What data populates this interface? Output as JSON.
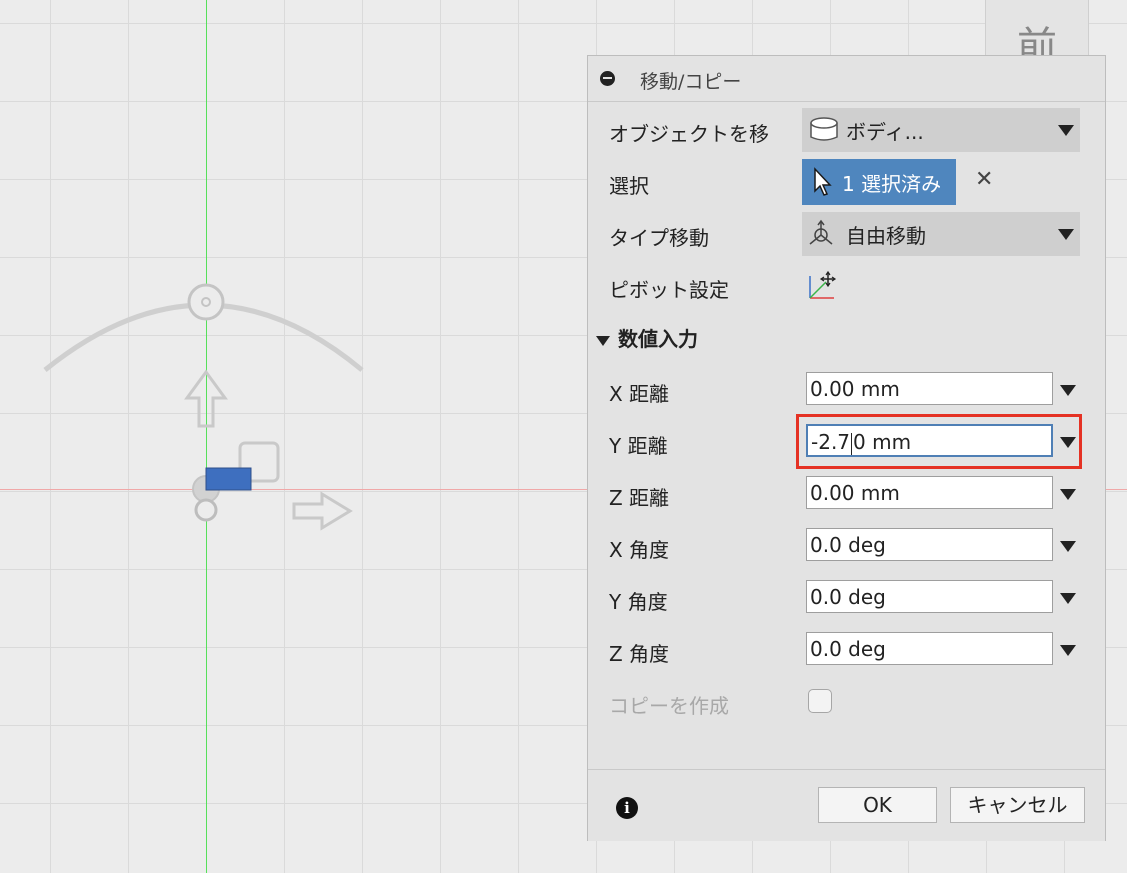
{
  "viewcube": {
    "label": "前"
  },
  "dialog": {
    "title": "移動/コピー",
    "rows": {
      "objects": {
        "label": "オブジェクトを移",
        "value": "ボディ..."
      },
      "selection": {
        "label": "選択",
        "value": "1 選択済み"
      },
      "move_type": {
        "label": "タイプ移動",
        "value": "自由移動"
      },
      "pivot": {
        "label": "ピボット設定"
      }
    },
    "section": {
      "title": "数値入力"
    },
    "fields": {
      "x_distance": {
        "label": "X 距離",
        "value": "0.00 mm"
      },
      "y_distance": {
        "label": "Y 距離",
        "value_before_cursor": "-2.7",
        "value_after_cursor": "0 mm"
      },
      "z_distance": {
        "label": "Z 距離",
        "value": "0.00 mm"
      },
      "x_angle": {
        "label": "X 角度",
        "value": "0.0 deg"
      },
      "y_angle": {
        "label": "Y 角度",
        "value": "0.0 deg"
      },
      "z_angle": {
        "label": "Z 角度",
        "value": "0.0 deg"
      }
    },
    "create_copy": {
      "label": "コピーを作成",
      "checked": false
    },
    "buttons": {
      "ok": "OK",
      "cancel": "キャンセル"
    }
  },
  "colors": {
    "selection_blue": "#4f86be",
    "highlight_red": "#e53224",
    "y_axis": "#56e05a",
    "x_axis": "#f0a8a8"
  },
  "icons": [
    "body-cylinder-icon",
    "pointer-arrow-icon",
    "close-icon",
    "free-move-icon",
    "pivot-icon",
    "info-icon",
    "dropdown-caret-icon"
  ]
}
